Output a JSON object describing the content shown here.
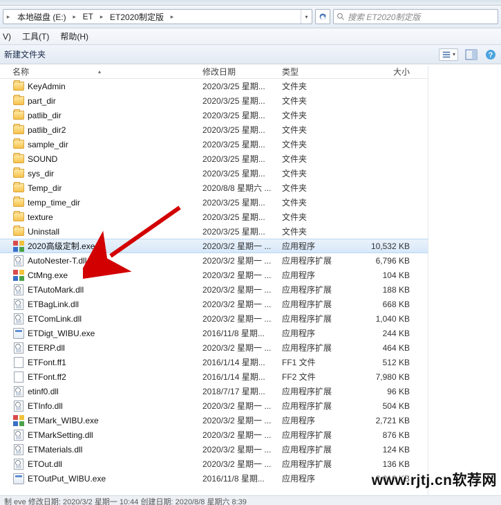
{
  "breadcrumbs": {
    "seg0": "",
    "seg1": "本地磁盘 (E:)",
    "seg2": "ET",
    "seg3": "ET2020制定版"
  },
  "search": {
    "placeholder": "搜索 ET2020制定版"
  },
  "menu": {
    "view": "V)",
    "tools": "工具(T)",
    "help": "帮助(H)"
  },
  "toolbar": {
    "new_folder": "新建文件夹"
  },
  "columns": {
    "name": "名称",
    "date": "修改日期",
    "type": "类型",
    "size": "大小"
  },
  "files": [
    {
      "icon": "folder",
      "name": "KeyAdmin",
      "date": "2020/3/25 星期...",
      "type": "文件夹",
      "size": ""
    },
    {
      "icon": "folder",
      "name": "part_dir",
      "date": "2020/3/25 星期...",
      "type": "文件夹",
      "size": ""
    },
    {
      "icon": "folder",
      "name": "patlib_dir",
      "date": "2020/3/25 星期...",
      "type": "文件夹",
      "size": ""
    },
    {
      "icon": "folder",
      "name": "patlib_dir2",
      "date": "2020/3/25 星期...",
      "type": "文件夹",
      "size": ""
    },
    {
      "icon": "folder",
      "name": "sample_dir",
      "date": "2020/3/25 星期...",
      "type": "文件夹",
      "size": ""
    },
    {
      "icon": "folder",
      "name": "SOUND",
      "date": "2020/3/25 星期...",
      "type": "文件夹",
      "size": ""
    },
    {
      "icon": "folder",
      "name": "sys_dir",
      "date": "2020/3/25 星期...",
      "type": "文件夹",
      "size": ""
    },
    {
      "icon": "folder",
      "name": "Temp_dir",
      "date": "2020/8/8 星期六 ...",
      "type": "文件夹",
      "size": ""
    },
    {
      "icon": "folder",
      "name": "temp_time_dir",
      "date": "2020/3/25 星期...",
      "type": "文件夹",
      "size": ""
    },
    {
      "icon": "folder",
      "name": "texture",
      "date": "2020/3/25 星期...",
      "type": "文件夹",
      "size": ""
    },
    {
      "icon": "folder",
      "name": "Uninstall",
      "date": "2020/3/25 星期...",
      "type": "文件夹",
      "size": ""
    },
    {
      "icon": "exe-col",
      "name": "2020高级定制.exe",
      "date": "2020/3/2 星期一 ...",
      "type": "应用程序",
      "size": "10,532 KB",
      "selected": true
    },
    {
      "icon": "dll",
      "name": "AutoNester-T.dll",
      "date": "2020/3/2 星期一 ...",
      "type": "应用程序扩展",
      "size": "6,796 KB"
    },
    {
      "icon": "exe-col",
      "name": "CtMng.exe",
      "date": "2020/3/2 星期一 ...",
      "type": "应用程序",
      "size": "104 KB"
    },
    {
      "icon": "dll",
      "name": "ETAutoMark.dll",
      "date": "2020/3/2 星期一 ...",
      "type": "应用程序扩展",
      "size": "188 KB"
    },
    {
      "icon": "dll",
      "name": "ETBagLink.dll",
      "date": "2020/3/2 星期一 ...",
      "type": "应用程序扩展",
      "size": "668 KB"
    },
    {
      "icon": "dll",
      "name": "ETComLink.dll",
      "date": "2020/3/2 星期一 ...",
      "type": "应用程序扩展",
      "size": "1,040 KB"
    },
    {
      "icon": "exe",
      "name": "ETDigt_WIBU.exe",
      "date": "2016/11/8 星期...",
      "type": "应用程序",
      "size": "244 KB"
    },
    {
      "icon": "dll",
      "name": "ETERP.dll",
      "date": "2020/3/2 星期一 ...",
      "type": "应用程序扩展",
      "size": "464 KB"
    },
    {
      "icon": "ff",
      "name": "ETFont.ff1",
      "date": "2016/1/14 星期...",
      "type": "FF1 文件",
      "size": "512 KB"
    },
    {
      "icon": "ff",
      "name": "ETFont.ff2",
      "date": "2016/1/14 星期...",
      "type": "FF2 文件",
      "size": "7,980 KB"
    },
    {
      "icon": "dll",
      "name": "etinf0.dll",
      "date": "2018/7/17 星期...",
      "type": "应用程序扩展",
      "size": "96 KB"
    },
    {
      "icon": "dll",
      "name": "ETInfo.dll",
      "date": "2020/3/2 星期一 ...",
      "type": "应用程序扩展",
      "size": "504 KB"
    },
    {
      "icon": "exe-col",
      "name": "ETMark_WIBU.exe",
      "date": "2020/3/2 星期一 ...",
      "type": "应用程序",
      "size": "2,721 KB"
    },
    {
      "icon": "dll",
      "name": "ETMarkSetting.dll",
      "date": "2020/3/2 星期一 ...",
      "type": "应用程序扩展",
      "size": "876 KB"
    },
    {
      "icon": "dll",
      "name": "ETMaterials.dll",
      "date": "2020/3/2 星期一 ...",
      "type": "应用程序扩展",
      "size": "124 KB"
    },
    {
      "icon": "dll",
      "name": "ETOut.dll",
      "date": "2020/3/2 星期一 ...",
      "type": "应用程序扩展",
      "size": "136 KB"
    },
    {
      "icon": "exe",
      "name": "ETOutPut_WIBU.exe",
      "date": "2016/11/8 星期...",
      "type": "应用程序",
      "size": "2,012 KB"
    }
  ],
  "statusbar": "制 eve    修改日期: 2020/3/2 星期一 10:44    创建日期: 2020/8/8 星期六 8:39",
  "watermark": "www.rjtj.cn软荐网"
}
